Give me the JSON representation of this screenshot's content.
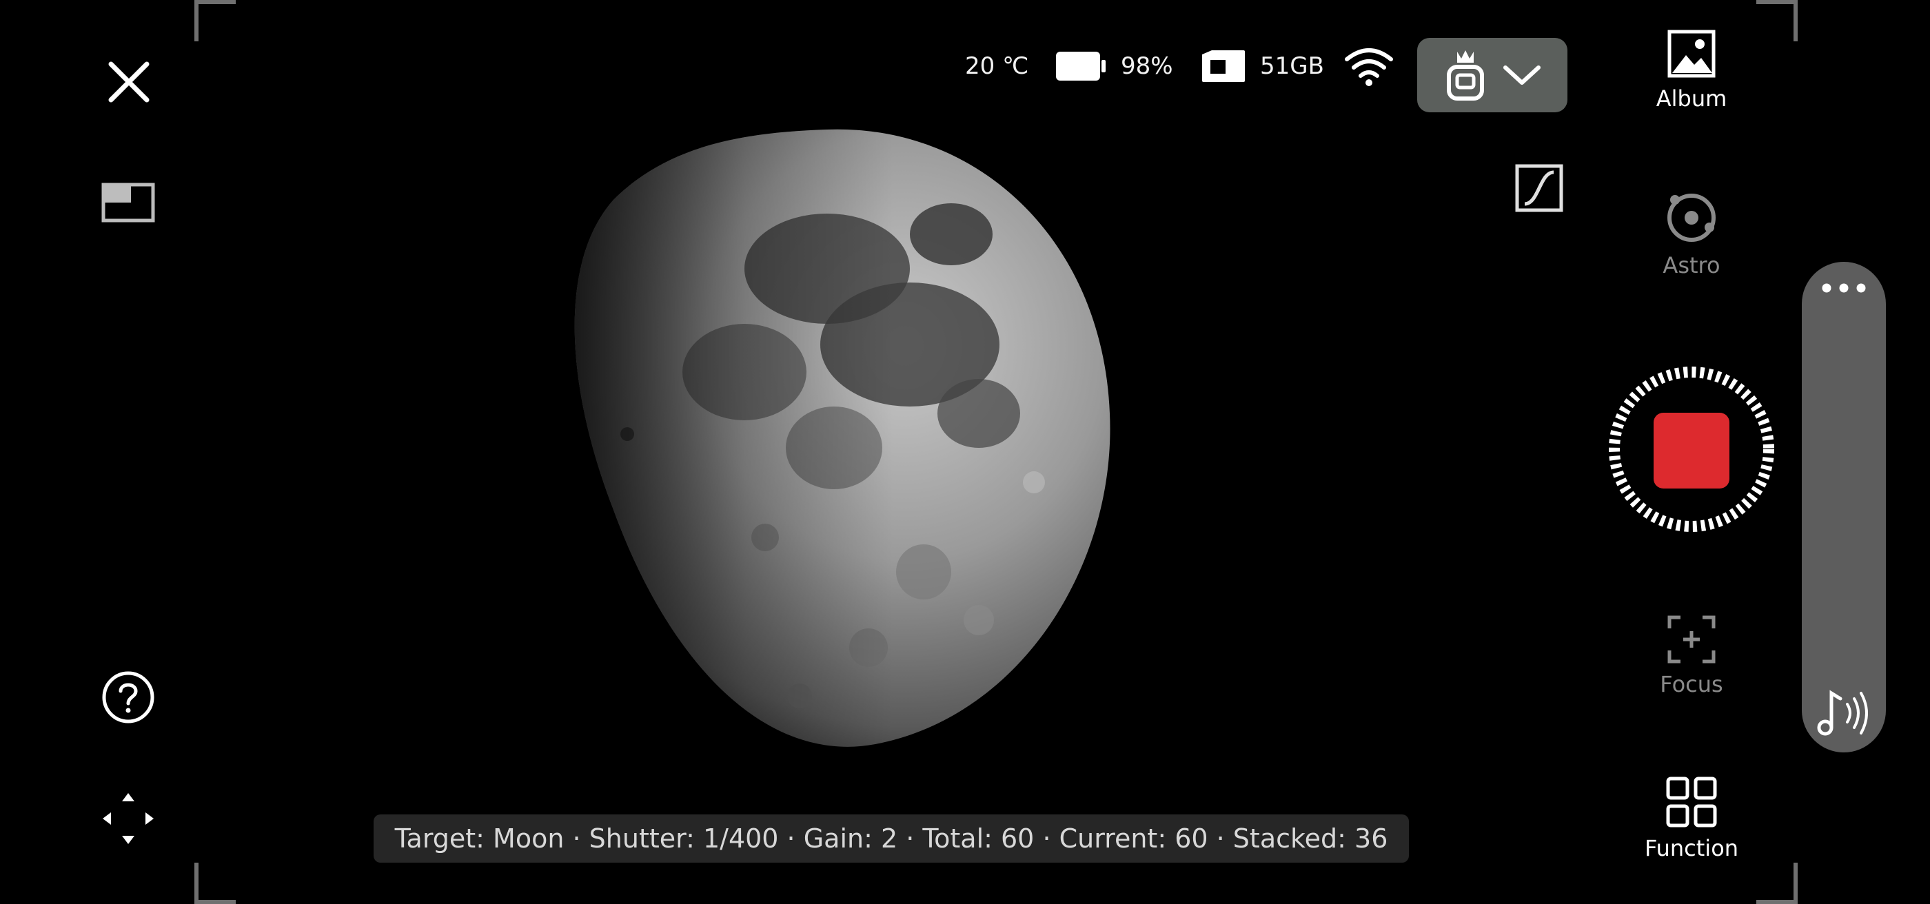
{
  "status": {
    "temperature": "20 ℃",
    "battery": "98%",
    "storage": "51GB"
  },
  "sidebar": {
    "album_label": "Album",
    "astro_label": "Astro",
    "focus_label": "Focus",
    "function_label": "Function"
  },
  "info_bar": {
    "text": "Target: Moon · Shutter: 1/400 · Gain: 2 · Total: 60 · Current: 60 · Stacked: 36"
  },
  "colors": {
    "record": "#dd2a2e",
    "device_button": "#5b5f5c",
    "slider_track": "#5d5d5d"
  },
  "icons": [
    "close-icon",
    "picture-in-picture-icon",
    "help-icon",
    "move-arrows-icon",
    "thermometer-readout",
    "battery-icon",
    "sd-card-icon",
    "wifi-icon",
    "telescope-device-icon",
    "chevron-down-icon",
    "curve-icon",
    "album-icon",
    "astro-icon",
    "record-stop-icon",
    "more-icon",
    "sound-icon",
    "focus-icon",
    "function-grid-icon"
  ]
}
